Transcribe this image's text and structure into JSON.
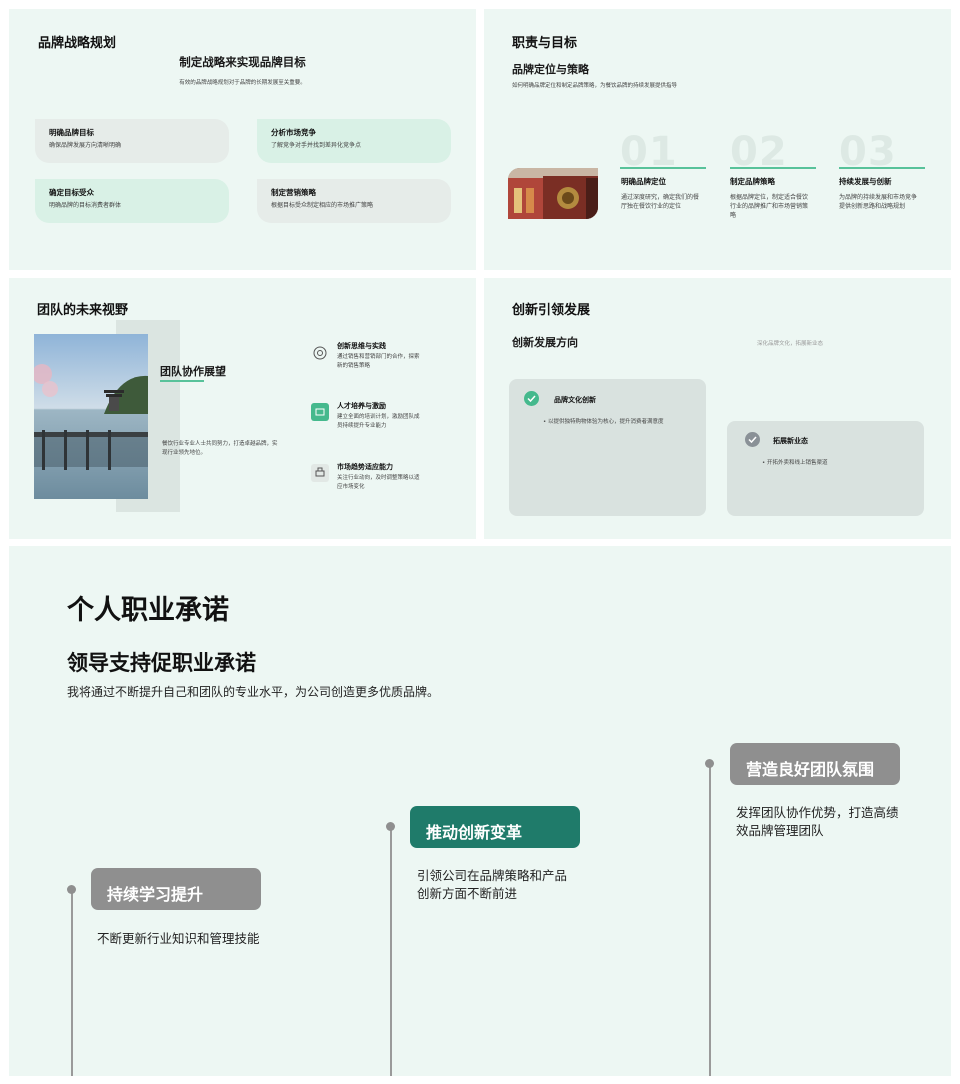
{
  "slide1": {
    "title": "品牌战略规划",
    "heading": "制定战略来实现品牌目标",
    "subtitle": "有效的品牌战略规划对于品牌的长期发展至关重要。",
    "cards": [
      {
        "title": "明确品牌目标",
        "desc": "确保品牌发展方向清晰明确"
      },
      {
        "title": "分析市场竞争",
        "desc": "了解竞争对手并找到差异化竞争点"
      },
      {
        "title": "确定目标受众",
        "desc": "明确品牌的目标消费者群体"
      },
      {
        "title": "制定营销策略",
        "desc": "根据目标受众制定相应的市场推广策略"
      }
    ]
  },
  "slide2": {
    "title": "职责与目标",
    "heading": "品牌定位与策略",
    "subtitle": "如何明确品牌定位和制定品牌策略，为餐饮品牌的持续发展提供指导",
    "items": [
      {
        "num": "01",
        "title": "明确品牌定位",
        "desc": "通过深度研究，确定我们的餐厅独在餐饮行业的定位"
      },
      {
        "num": "02",
        "title": "制定品牌策略",
        "desc": "根据品牌定位，制定适合餐饮行业的品牌推广和市场营销策略"
      },
      {
        "num": "03",
        "title": "持续发展与创新",
        "desc": "为品牌的持续发展和市场竞争提供创新思路和战略规划"
      }
    ]
  },
  "slide3": {
    "title": "团队的未来视野",
    "subheading": "团队协作展望",
    "body": "餐饮行业专业人士共同努力，打造卓越品牌，实现行业领先地位。",
    "items": [
      {
        "icon": "lightbulb-icon",
        "title": "创新思维与实践",
        "desc": "通过销售和营销部门的合作，探索新的销售策略"
      },
      {
        "icon": "people-icon",
        "title": "人才培养与激励",
        "desc": "建立全面的培训计划，激励团队成员持续提升专业能力"
      },
      {
        "icon": "printer-icon",
        "title": "市场趋势适应能力",
        "desc": "关注行业动向，及时调整策略以适应市场变化"
      }
    ]
  },
  "slide4": {
    "title": "创新引领发展",
    "heading": "创新发展方向",
    "note": "深化品牌文化，拓展新业态",
    "panels": [
      {
        "title": "品牌文化创新",
        "bullet": "以提供独特购物体验为核心，提升消费者满意度"
      },
      {
        "title": "拓展新业态",
        "bullet": "开拓外卖和线上销售渠道"
      }
    ]
  },
  "slide5": {
    "title": "个人职业承诺",
    "heading": "领导支持促职业承诺",
    "subtitle": "我将通过不断提升自己和团队的专业水平，为公司创造更多优质品牌。",
    "steps": [
      {
        "label": "持续学习提升",
        "desc": "不断更新行业知识和管理技能"
      },
      {
        "label": "推动创新变革",
        "desc": "引领公司在品牌策略和产品创新方面不断前进"
      },
      {
        "label": "营造良好团队氛围",
        "desc": "发挥团队协作优势，打造高绩效品牌管理团队"
      }
    ]
  },
  "colors": {
    "background": "#edf7f3",
    "accent": "#1f7b6a",
    "light_green": "#d9f1e6",
    "grey_tag": "#8f8f8f"
  }
}
